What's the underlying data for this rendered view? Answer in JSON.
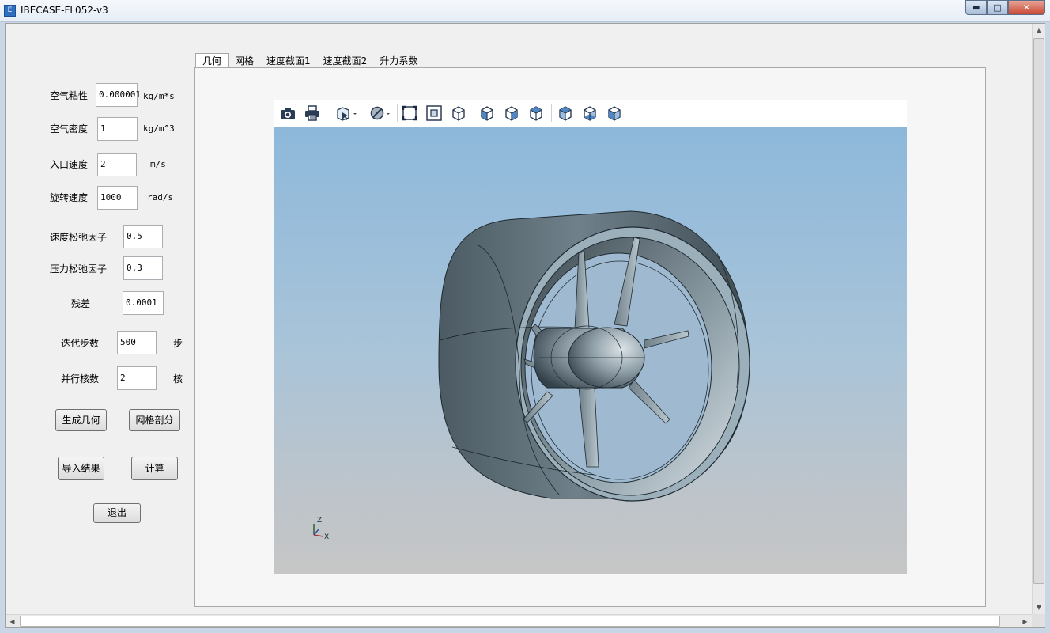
{
  "window": {
    "title": "IBECASE-FL052-v3",
    "app_icon": "app-icon",
    "min": "▬",
    "max": "□",
    "close": "✕"
  },
  "params": {
    "air_viscosity": {
      "label": "空气粘性",
      "value": "0.000001",
      "unit": "kg/m*s"
    },
    "air_density": {
      "label": "空气密度",
      "value": "1",
      "unit": "kg/m^3"
    },
    "inlet_velocity": {
      "label": "入口速度",
      "value": "2",
      "unit": "m/s"
    },
    "rotation_speed": {
      "label": "旋转速度",
      "value": "1000",
      "unit": "rad/s"
    },
    "velocity_relax": {
      "label": "速度松弛因子",
      "value": "0.5"
    },
    "pressure_relax": {
      "label": "压力松弛因子",
      "value": "0.3"
    },
    "residual": {
      "label": "残差",
      "value": "0.0001"
    },
    "iterations": {
      "label": "迭代步数",
      "value": "500",
      "unit": "步"
    },
    "cores": {
      "label": "并行核数",
      "value": "2",
      "unit": "核"
    }
  },
  "buttons": {
    "generate_geometry": "生成几何",
    "mesh": "网格剖分",
    "import_results": "导入结果",
    "compute": "计算",
    "exit": "退出"
  },
  "tabs": [
    "几何",
    "网格",
    "速度截面1",
    "速度截面2",
    "升力系数"
  ],
  "active_tab": "几何",
  "viewer": {
    "toolbar_icons": [
      "camera-icon",
      "print-icon",
      "select-icon",
      "no-entry-icon",
      "fit-view-icon",
      "zoom-box-icon",
      "iso-view-icon",
      "front-view-icon",
      "back-view-icon",
      "left-view-icon",
      "right-view-icon",
      "top-view-icon",
      "bottom-view-icon"
    ],
    "axis": {
      "z": "Z",
      "x": "X"
    },
    "background_top": "#8db8da",
    "background_bottom": "#c6c6c6",
    "model_color": "#5f7079"
  }
}
